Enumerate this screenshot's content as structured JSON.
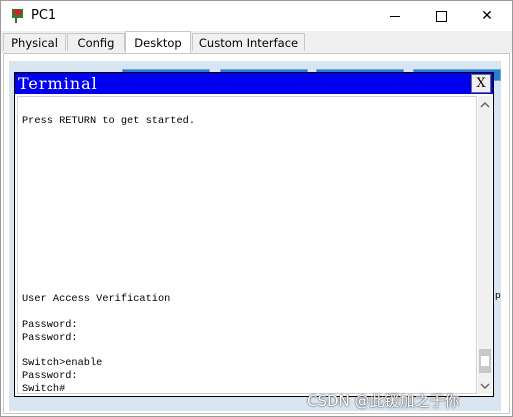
{
  "window": {
    "title": "PC1",
    "controls": {
      "minimize_icon": "minimize-icon",
      "maximize_icon": "maximize-icon",
      "close_label": "✕"
    }
  },
  "tabs": [
    {
      "label": "Physical",
      "active": false
    },
    {
      "label": "Config",
      "active": false
    },
    {
      "label": "Desktop",
      "active": true
    },
    {
      "label": "Custom Interface",
      "active": false
    }
  ],
  "desktop": {
    "edge_mark": "p"
  },
  "terminal": {
    "title": "Terminal",
    "close_label": "X",
    "lines": [
      "Press RETURN to get started.",
      "User Access Verification",
      "Password:",
      "Password:",
      "Switch>enable",
      "Password:",
      "Switch#"
    ]
  },
  "watermark": "CSDN @此锾加之于你",
  "colors": {
    "terminal_titlebar": "#0000ee",
    "terminal_title_text": "#ffffff",
    "desktop_background": "#d9e6f1"
  }
}
